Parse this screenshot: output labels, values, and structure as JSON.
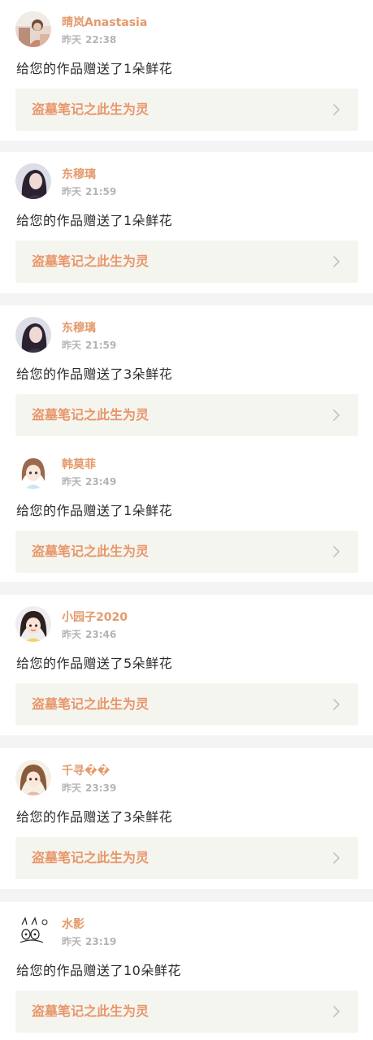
{
  "notifications": [
    {
      "username": "晴岚Anastasia",
      "day": "昨天",
      "time": "22:38",
      "message": "给您的作品赠送了1朵鲜花",
      "work_title": "盗墓笔记之此生为灵",
      "avatar_icon": "photo-avatar-icon"
    },
    {
      "username": "东穆璃",
      "day": "昨天",
      "time": "21:59",
      "message": "给您的作品赠送了1朵鲜花",
      "work_title": "盗墓笔记之此生为灵",
      "avatar_icon": "portrait-avatar-icon"
    },
    {
      "username": "东穆璃",
      "day": "昨天",
      "time": "21:59",
      "message": "给您的作品赠送了3朵鲜花",
      "work_title": "盗墓笔记之此生为灵",
      "avatar_icon": "portrait-avatar-icon"
    },
    {
      "username": "韩莫菲",
      "day": "昨天",
      "time": "23:49",
      "message": "给您的作品赠送了1朵鲜花",
      "work_title": "盗墓笔记之此生为灵",
      "avatar_icon": "anime-girl-avatar-icon"
    },
    {
      "username": "小园子2020",
      "day": "昨天",
      "time": "23:46",
      "message": "给您的作品赠送了5朵鲜花",
      "work_title": "盗墓笔记之此生为灵",
      "avatar_icon": "cartoon-girl-avatar-icon"
    },
    {
      "username": "千寻��",
      "day": "昨天",
      "time": "23:39",
      "message": "给您的作品赠送了3朵鲜花",
      "work_title": "盗墓笔记之此生为灵",
      "avatar_icon": "anime-girl-avatar-icon"
    },
    {
      "username": "水影",
      "day": "昨天",
      "time": "23:19",
      "message": "给您的作品赠送了10朵鲜花",
      "work_title": "盗墓笔记之此生为灵",
      "avatar_icon": "doodle-avatar-icon"
    }
  ],
  "colors": {
    "username": "#e49a6b",
    "work_title": "#e8966a",
    "time": "#b4b4b4",
    "link_bg": "#f5f5ef",
    "separator": "#f4f4f4"
  }
}
